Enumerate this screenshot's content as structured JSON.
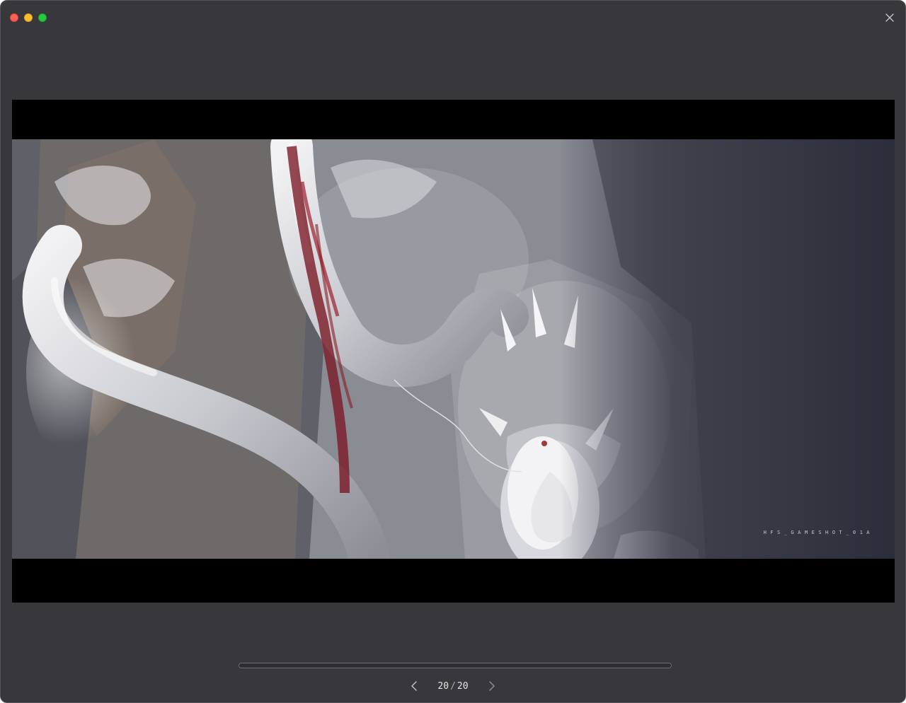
{
  "window": {
    "controls": [
      "close-dot",
      "minimize-dot",
      "zoom-dot"
    ],
    "close_icon": "close-icon"
  },
  "image": {
    "description_icon": "artwork-image",
    "watermark": "HFS_GAMESHOT_01A"
  },
  "progress": {
    "fraction": 1.0
  },
  "pager": {
    "current": "20",
    "separator": "/",
    "total": "20",
    "prev_icon": "chevron-left-icon",
    "next_icon": "chevron-right-icon"
  },
  "colors": {
    "window_bg": "#38383c",
    "viewer_bg": "#000000",
    "close_dot": "#fe5f57",
    "minimize_dot": "#febc2e",
    "zoom_dot": "#28c840"
  }
}
